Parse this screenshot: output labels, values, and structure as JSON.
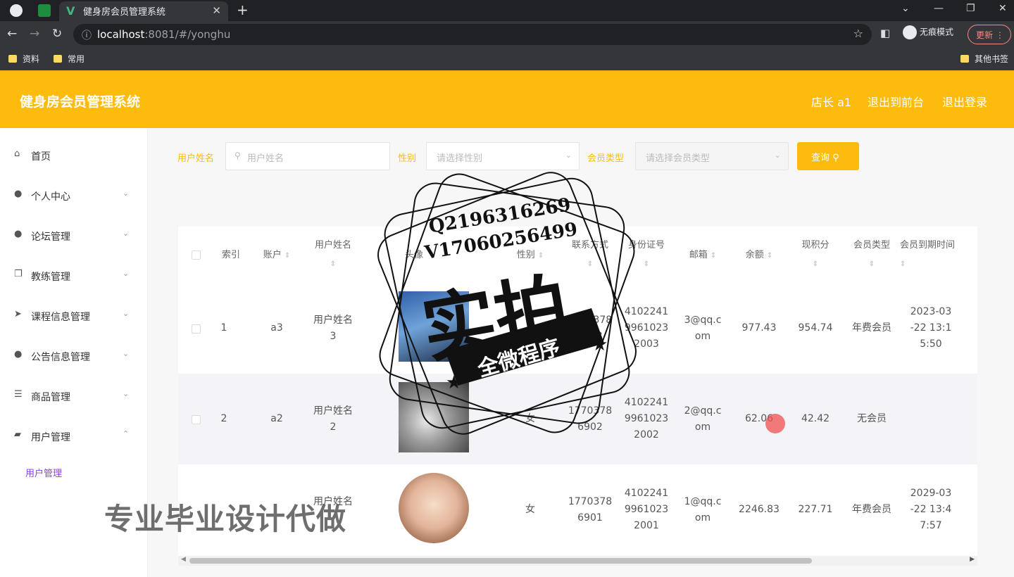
{
  "browser": {
    "tab_title": "健身房会员管理系统",
    "url_host": "localhost",
    "url_path": ":8081/#/yonghu",
    "incognito_label": "无痕模式",
    "update_label": "更新",
    "bookmarks": [
      "资料",
      "常用"
    ],
    "other_bookmarks": "其他书签"
  },
  "header": {
    "title": "健身房会员管理系统",
    "role_user": "店长 a1",
    "back_to_front": "退出到前台",
    "logout": "退出登录"
  },
  "sidebar": {
    "items": [
      {
        "label": "首页",
        "icon": "home-icon",
        "expandable": false
      },
      {
        "label": "个人中心",
        "icon": "user-icon",
        "expandable": true
      },
      {
        "label": "论坛管理",
        "icon": "bulb-icon",
        "expandable": true
      },
      {
        "label": "教练管理",
        "icon": "copy-icon",
        "expandable": true
      },
      {
        "label": "课程信息管理",
        "icon": "send-icon",
        "expandable": true
      },
      {
        "label": "公告信息管理",
        "icon": "user-icon",
        "expandable": true
      },
      {
        "label": "商品管理",
        "icon": "list-icon",
        "expandable": true
      },
      {
        "label": "用户管理",
        "icon": "folder-icon",
        "expandable": true,
        "expanded": true
      }
    ],
    "sub_item": "用户管理"
  },
  "search": {
    "name_label": "用户姓名",
    "name_placeholder": "用户姓名",
    "gender_label": "性别",
    "gender_placeholder": "请选择性别",
    "type_label": "会员类型",
    "type_placeholder": "请选择会员类型",
    "query_button": "查询"
  },
  "table": {
    "columns": [
      "索引",
      "账户",
      "用户姓名",
      "头像",
      "性别",
      "联系方式",
      "身份证号",
      "邮箱",
      "余额",
      "现积分",
      "会员类型",
      "会员到期时间"
    ],
    "rows": [
      {
        "index": "1",
        "account": "a3",
        "name": "用户姓名\n3",
        "gender": "",
        "phone": "1770378\n6903",
        "idcard": "4102241\n9961023\n2003",
        "email": "3@qq.c\nom",
        "balance": "977.43",
        "points": "954.74",
        "type": "年费会员",
        "expire": "2023-03\n-22 13:1\n5:50"
      },
      {
        "index": "2",
        "account": "a2",
        "name": "用户姓名\n2",
        "gender": "女",
        "phone": "1770378\n6902",
        "idcard": "4102241\n9961023\n2002",
        "email": "2@qq.c\nom",
        "balance": "62.06",
        "points": "42.42",
        "type": "无会员",
        "expire": ""
      },
      {
        "index": "",
        "account": "",
        "name": "用户姓名",
        "gender": "女",
        "phone": "1770378\n6901",
        "idcard": "4102241\n9961023\n2001",
        "email": "1@qq.c\nom",
        "balance": "2246.83",
        "points": "227.71",
        "type": "年费会员",
        "expire": "2029-03\n-22 13:4\n7:57"
      }
    ]
  },
  "watermark": {
    "qq": "Q2196316269",
    "wechat": "V17060256499",
    "big": "实拍",
    "banner": "全微程序",
    "overlay": "专业毕业设计代做"
  },
  "colors": {
    "accent": "#fdbc0d",
    "sub_menu": "#8a3ffc"
  }
}
